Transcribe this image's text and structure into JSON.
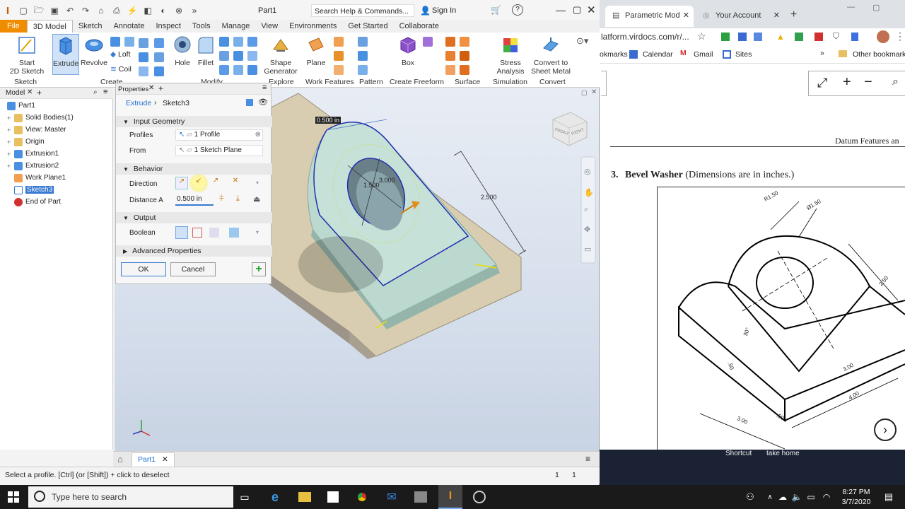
{
  "inventor": {
    "doc_title": "Part1",
    "search_placeholder": "Search Help & Commands...",
    "sign_in": "Sign In",
    "tabs": [
      "File",
      "3D Model",
      "Sketch",
      "Annotate",
      "Inspect",
      "Tools",
      "Manage",
      "View",
      "Environments",
      "Get Started",
      "Collaborate"
    ],
    "ribbon": {
      "start_sketch": "Start\n2D Sketch",
      "start_sketch_l1": "Start",
      "start_sketch_l2": "2D Sketch",
      "extrude": "Extrude",
      "revolve": "Revolve",
      "loft": "Loft",
      "coil": "Coil",
      "hole": "Hole",
      "fillet": "Fillet",
      "shape_gen_l1": "Shape",
      "shape_gen_l2": "Generator",
      "plane": "Plane",
      "box": "Box",
      "stress_l1": "Stress",
      "stress_l2": "Analysis",
      "convert_l1": "Convert to",
      "convert_l2": "Sheet Metal",
      "groups": [
        "Sketch",
        "Create",
        "Modify",
        "Explore",
        "Work Features",
        "Pattern",
        "Create Freeform",
        "Surface",
        "Simulation",
        "Convert"
      ]
    },
    "browser": {
      "title": "Model",
      "items": [
        "Part1",
        "Solid Bodies(1)",
        "View: Master",
        "Origin",
        "Extrusion1",
        "Extrusion2",
        "Work Plane1",
        "Sketch3",
        "End of Part"
      ]
    },
    "props": {
      "title": "Properties",
      "breadcrumb_feature": "Extrude",
      "breadcrumb_sketch": "Sketch3",
      "input_geometry": "Input Geometry",
      "profiles_label": "Profiles",
      "profiles_value": "1 Profile",
      "from_label": "From",
      "from_value": "1 Sketch Plane",
      "behavior": "Behavior",
      "direction_label": "Direction",
      "distance_label": "Distance A",
      "distance_value": "0.500 in",
      "output": "Output",
      "boolean_label": "Boolean",
      "advanced": "Advanced Properties",
      "ok": "OK",
      "cancel": "Cancel"
    },
    "viewport": {
      "dim_top": "0.500 in",
      "dim_right": "2.500",
      "dim_a": "1.500",
      "dim_b": "3.000",
      "viewcube_front": "FRONT",
      "viewcube_right": "RIGHT"
    },
    "doc_tab": "Part1",
    "status_text": "Select a profile. [Ctrl] (or [Shift]) + click to deselect",
    "status_num1": "1",
    "status_num2": "1"
  },
  "chrome": {
    "tab1": "Parametric Mod",
    "tab2": "Your Account",
    "url": "latform.virdocs.com/r/...",
    "bookmarks": [
      "okmarks",
      "Calendar",
      "Gmail",
      "Sites"
    ],
    "other_bookmarks": "Other bookmarks",
    "doc_header": "Datum Features an",
    "problem_number": "3.",
    "problem_title": "Bevel Washer",
    "problem_note": "(Dimensions are in inches.)",
    "drawing_labels": [
      "R1.50",
      "Ø1.50",
      "2.50",
      "3.00",
      "4.00",
      "3.00",
      ".50",
      ".50",
      "30°"
    ],
    "strip_left": "Shortcut",
    "strip_right": "take home"
  },
  "taskbar": {
    "search_placeholder": "Type here to search",
    "time": "8:27 PM",
    "date": "3/7/2020"
  },
  "colors": {
    "file_tab": "#f08c00",
    "accent": "#1e6fd0",
    "part_face": "#b8d8d0"
  }
}
